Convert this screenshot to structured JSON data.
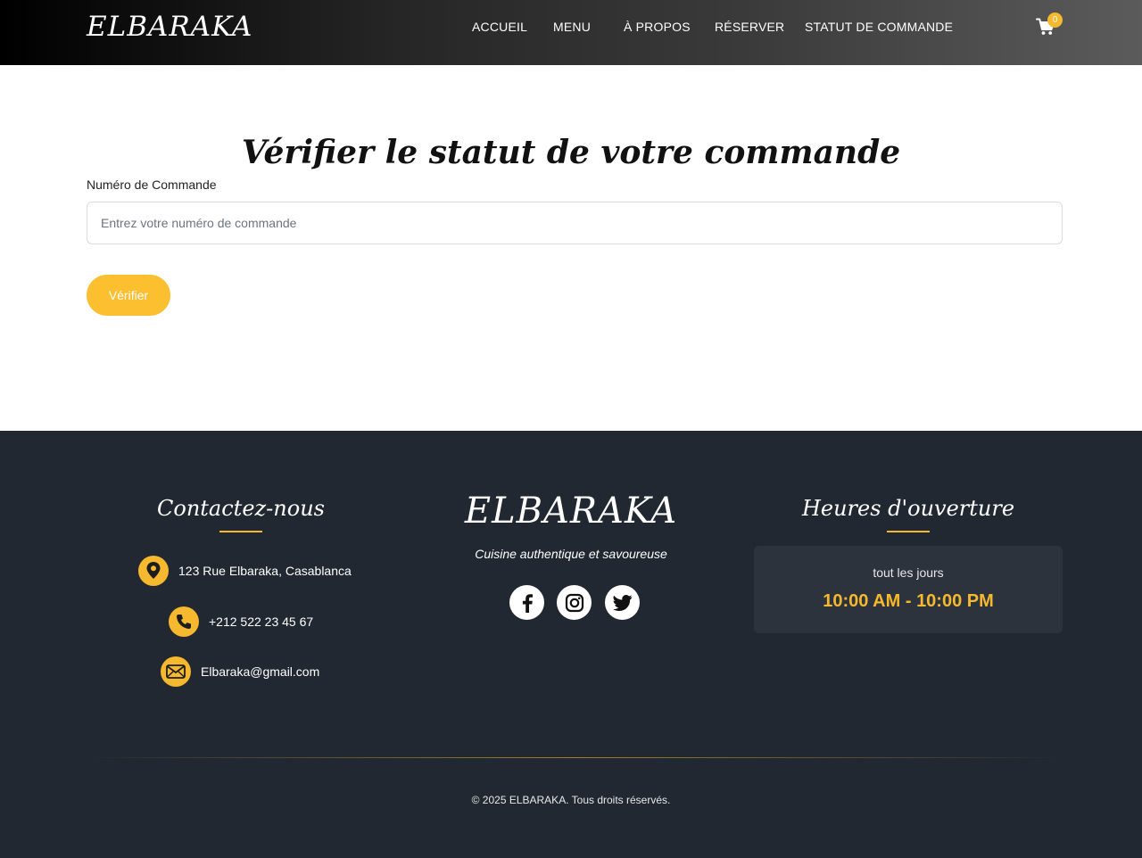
{
  "navbar": {
    "brand": "ELBARAKA",
    "links": [
      "ACCUEIL",
      "MENU",
      "À PROPOS",
      "RÉSERVER",
      "STATUT DE COMMANDE"
    ],
    "cart_count": "0",
    "cart_icon": "shopping-cart-icon"
  },
  "main": {
    "title": "Vérifier le statut de votre commande",
    "field_label": "Numéro de Commande",
    "input_placeholder": "Entrez votre numéro de commande",
    "input_value": "",
    "button_label": "Vérifier"
  },
  "footer": {
    "contact": {
      "heading": "Contactez-nous",
      "address": "123 Rue Elbaraka, Casablanca",
      "phone": "+212 522 23 45 67",
      "email": "Elbaraka@gmail.com"
    },
    "brand": {
      "name": "ELBARAKA",
      "tagline": "Cuisine authentique et savoureuse",
      "socials": [
        "facebook-icon",
        "instagram-icon",
        "twitter-icon"
      ]
    },
    "hours": {
      "heading": "Heures d'ouverture",
      "days": "tout les jours",
      "time": "10:00 AM - 10:00 PM"
    },
    "copyright": "© 2025 ELBARAKA. Tous droits réservés."
  },
  "colors": {
    "accent": "#f5b82e",
    "button": "#fbbf2f",
    "footer_bg": "#222831",
    "hours_card_bg": "#2d333d"
  }
}
